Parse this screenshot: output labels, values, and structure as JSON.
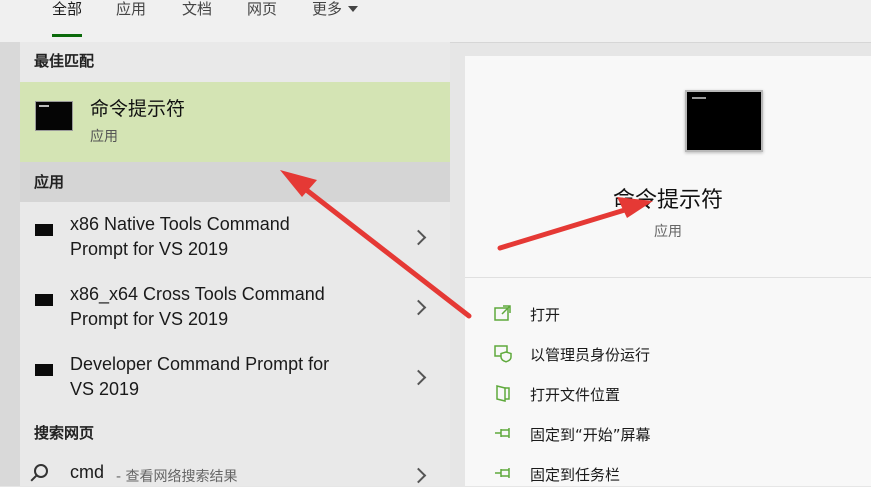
{
  "tabs": [
    {
      "label": "全部",
      "active": true
    },
    {
      "label": "应用",
      "active": false
    },
    {
      "label": "文档",
      "active": false
    },
    {
      "label": "网页",
      "active": false
    },
    {
      "label": "更多",
      "active": false
    }
  ],
  "left": {
    "best_match_header": "最佳匹配",
    "best_match": {
      "title": "命令提示符",
      "subtitle": "应用",
      "icon": "command-prompt-icon"
    },
    "apps_header": "应用",
    "apps": [
      {
        "line1": "x86 Native Tools Command",
        "line2": "Prompt for VS 2019",
        "icon": "terminal-icon"
      },
      {
        "line1": "x86_x64 Cross Tools Command",
        "line2": "Prompt for VS 2019",
        "icon": "terminal-icon"
      },
      {
        "line1": "Developer Command Prompt for",
        "line2": "VS 2019",
        "icon": "terminal-icon"
      }
    ],
    "web_header": "搜索网页",
    "web": {
      "query": "cmd",
      "hint": "- 查看网络搜索结果",
      "icon": "search-icon"
    }
  },
  "right": {
    "title": "命令提示符",
    "kind": "应用",
    "actions": [
      {
        "label": "打开",
        "icon": "open-icon"
      },
      {
        "label": "以管理员身份运行",
        "icon": "admin-shield-icon"
      },
      {
        "label": "打开文件位置",
        "icon": "file-location-icon"
      },
      {
        "label": "固定到“开始”屏幕",
        "icon": "pin-icon"
      },
      {
        "label": "固定到任务栏",
        "icon": "pin-icon"
      }
    ]
  },
  "colors": {
    "accent_green": "#5fa93c",
    "selected_bg": "#d4e4b4",
    "annotation_red": "#e53935"
  }
}
